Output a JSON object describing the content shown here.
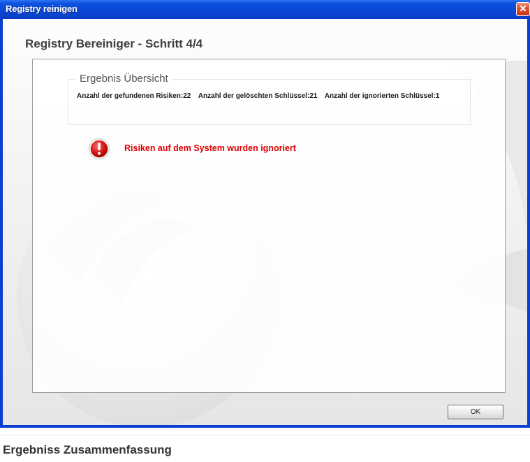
{
  "window": {
    "title": "Registry reinigen",
    "close_label": "✕"
  },
  "wizard": {
    "step_title": "Registry Bereiniger - Schritt 4/4"
  },
  "summary": {
    "legend": "Ergebnis Übersicht",
    "risks_found": "Anzahl der gefundenen Risiken:22",
    "keys_deleted": "Anzahl der gelöschten Schlüssel:21",
    "keys_ignored": "Anzahl der ignorierten Schlüssel:1"
  },
  "status": {
    "icon": "warning-exclamation-icon",
    "message": "Risiken auf dem System wurden ignoriert",
    "color": "#e00000"
  },
  "footer": {
    "ok_label": "OK"
  },
  "caption": {
    "text": "Ergebniss Zusammenfassung"
  },
  "colors": {
    "titlebar": "#0a46d3",
    "accent_red": "#e00000"
  }
}
